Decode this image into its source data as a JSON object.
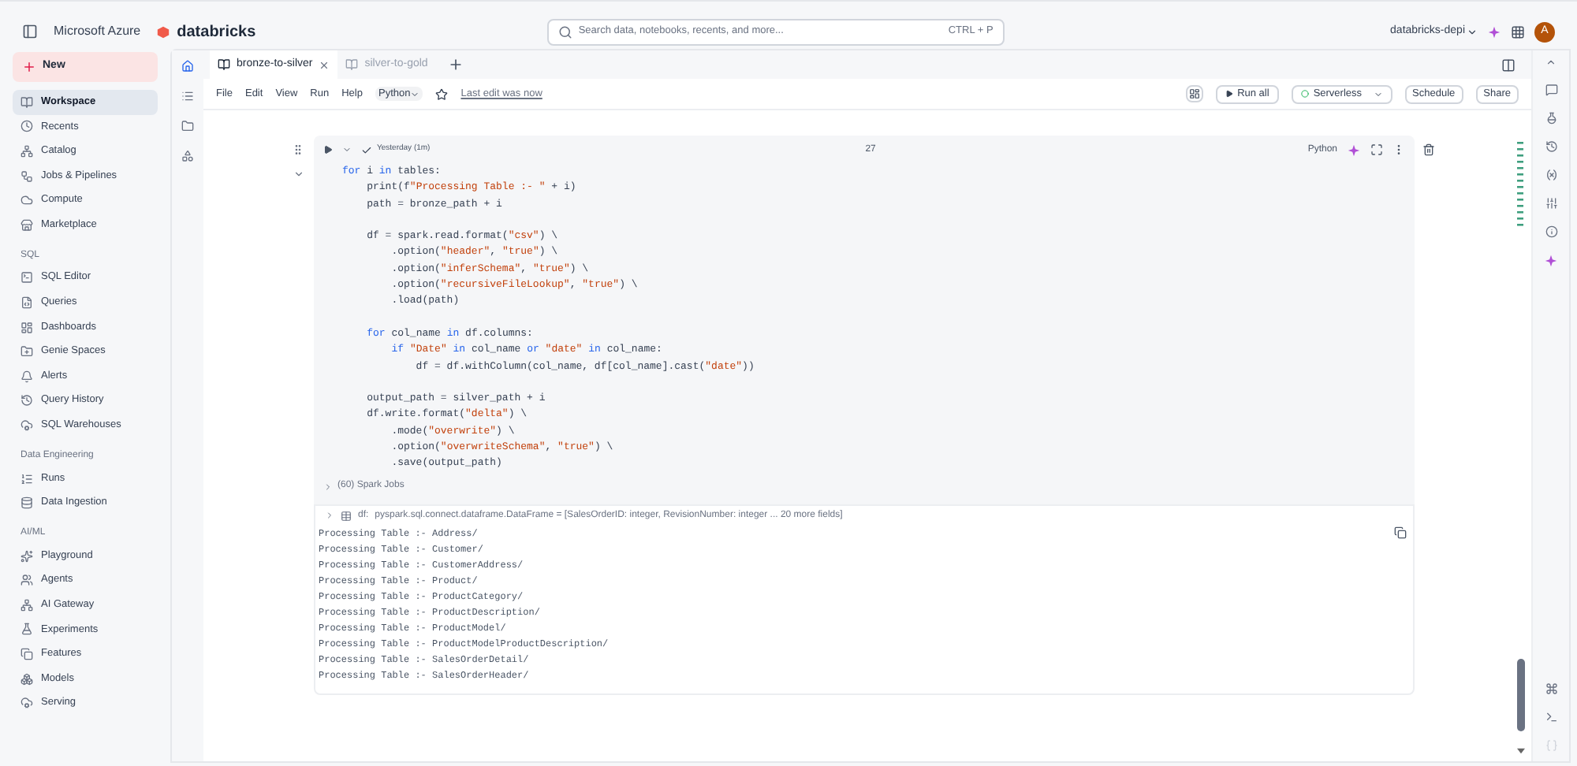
{
  "header": {
    "brand_left": "Microsoft Azure",
    "brand_logo": "databricks",
    "search": {
      "placeholder": "Search data, notebooks, recents, and more...",
      "shortcut": "CTRL + P"
    },
    "workspace": "databricks-depi",
    "avatar": "A"
  },
  "sidebar": {
    "new_button": "New",
    "sections": [
      {
        "items": [
          {
            "label": "Workspace",
            "selected": true
          },
          {
            "label": "Recents",
            "selected": false
          },
          {
            "label": "Catalog",
            "selected": false
          },
          {
            "label": "Jobs & Pipelines",
            "selected": false
          },
          {
            "label": "Compute",
            "selected": false
          },
          {
            "label": "Marketplace",
            "selected": false
          }
        ]
      },
      {
        "title": "SQL",
        "items": [
          {
            "label": "SQL Editor",
            "selected": false
          },
          {
            "label": "Queries",
            "selected": false
          },
          {
            "label": "Dashboards",
            "selected": false
          },
          {
            "label": "Genie Spaces",
            "selected": false
          },
          {
            "label": "Alerts",
            "selected": false
          },
          {
            "label": "Query History",
            "selected": false
          },
          {
            "label": "SQL Warehouses",
            "selected": false
          }
        ]
      },
      {
        "title": "Data Engineering",
        "items": [
          {
            "label": "Runs",
            "selected": false
          },
          {
            "label": "Data Ingestion",
            "selected": false
          }
        ]
      },
      {
        "title": "AI/ML",
        "items": [
          {
            "label": "Playground",
            "selected": false
          },
          {
            "label": "Agents",
            "selected": false
          },
          {
            "label": "AI Gateway",
            "selected": false
          },
          {
            "label": "Experiments",
            "selected": false
          },
          {
            "label": "Features",
            "selected": false
          },
          {
            "label": "Models",
            "selected": false
          },
          {
            "label": "Serving",
            "selected": false
          }
        ]
      }
    ]
  },
  "tabs": [
    {
      "label": "bronze-to-silver",
      "selected": true
    },
    {
      "label": "silver-to-gold",
      "selected": false
    }
  ],
  "menu": [
    "File",
    "Edit",
    "View",
    "Run",
    "Help"
  ],
  "language": "Python",
  "last_edit": "Last edit was now",
  "toolbar": {
    "run_all": "Run all",
    "compute": "Serverless",
    "schedule": "Schedule",
    "share": "Share"
  },
  "cell": {
    "status": "Yesterday (1m)",
    "number": "27",
    "language": "Python",
    "code_blocks": [
      [
        "for i in tables:",
        "    print(f\"Processing Table :- \" + i)",
        "    path = bronze_path + i"
      ],
      [
        "    df = spark.read.format(\"csv\") \\",
        "        .option(\"header\", \"true\") \\",
        "        .option(\"inferSchema\", \"true\") \\",
        "        .option(\"recursiveFileLookup\", \"true\") \\",
        "        .load(path)"
      ],
      [
        "    for col_name in df.columns:",
        "        if \"Date\" in col_name or \"date\" in col_name:",
        "            df = df.withColumn(col_name, df[col_name].cast(\"date\"))"
      ],
      [
        "    output_path = silver_path + i",
        "    df.write.format(\"delta\") \\",
        "        .mode(\"overwrite\") \\",
        "        .option(\"overwriteSchema\", \"true\") \\",
        "        .save(output_path)"
      ]
    ],
    "spark_jobs": "(60) Spark Jobs",
    "df_name": "df:",
    "df_schema": "pyspark.sql.connect.dataframe.DataFrame = [SalesOrderID: integer, RevisionNumber: integer ... 20 more fields]",
    "output": [
      "Processing Table :- Address/",
      "Processing Table :- Customer/",
      "Processing Table :- CustomerAddress/",
      "Processing Table :- Product/",
      "Processing Table :- ProductCategory/",
      "Processing Table :- ProductDescription/",
      "Processing Table :- ProductModel/",
      "Processing Table :- ProductModelProductDescription/",
      "Processing Table :- SalesOrderDetail/",
      "Processing Table :- SalesOrderHeader/"
    ]
  }
}
